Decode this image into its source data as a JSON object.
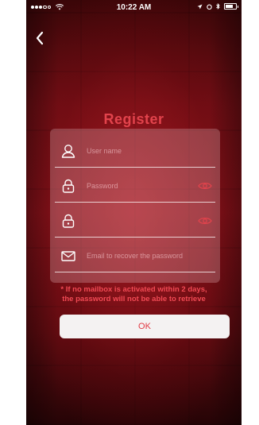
{
  "status_bar": {
    "time": "10:22 AM"
  },
  "page": {
    "title": "Register"
  },
  "form": {
    "username_placeholder": "User name",
    "password_placeholder": "Password",
    "confirm_placeholder": "",
    "email_placeholder": "Email to recover the password"
  },
  "notice": {
    "line1": "* If no mailbox is activated within 2 days,",
    "line2": "the password will not be able to retrieve"
  },
  "actions": {
    "ok_label": "OK"
  },
  "colors": {
    "accent": "#e2434c",
    "notice": "#f04a54",
    "button_bg": "#f4f2f2"
  }
}
